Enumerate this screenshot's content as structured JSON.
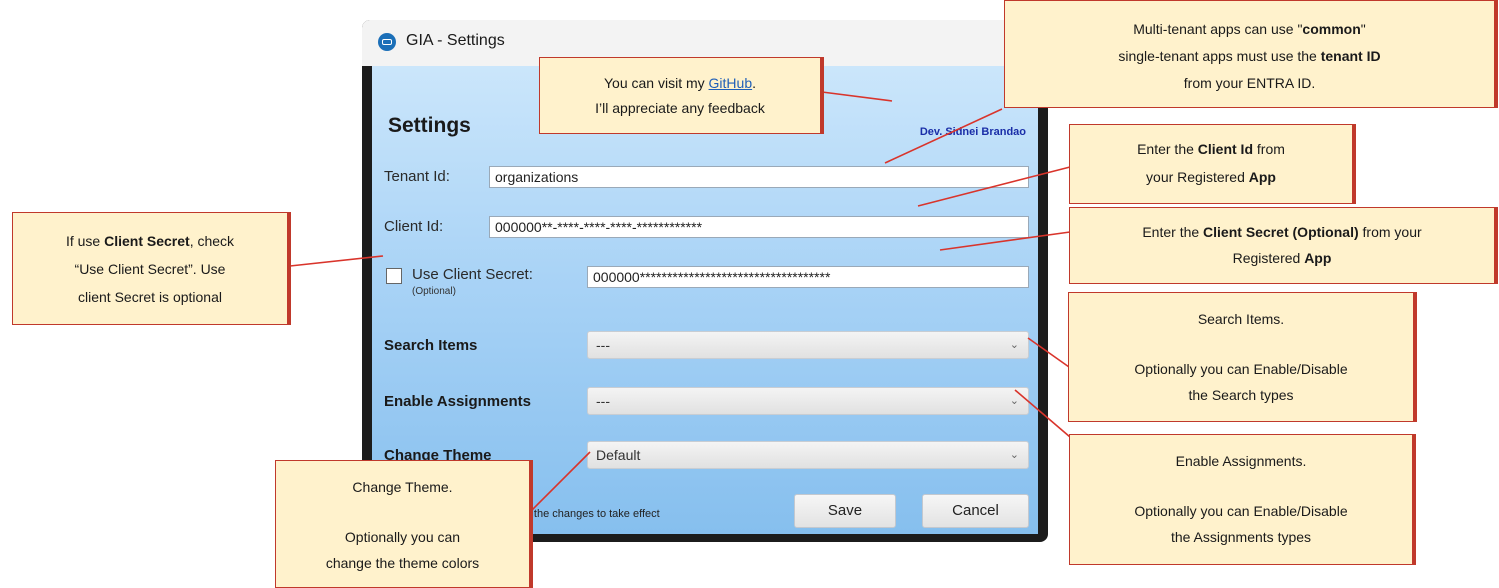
{
  "window": {
    "title": "GIA - Settings",
    "close_glyph": "✕",
    "app_icon": "app-icon"
  },
  "settings": {
    "heading": "Settings",
    "developer": "Dev. Sidnei Brandao",
    "tenant_label": "Tenant Id:",
    "tenant_value": "organizations",
    "client_label": "Client Id:",
    "client_value": "000000**-****-****-****-************",
    "use_secret_label": "Use Client Secret:",
    "use_secret_optional": "(Optional)",
    "use_secret_checked": false,
    "secret_value": "000000***********************************",
    "search_items_label": "Search Items",
    "search_items_value": "---",
    "enable_assignments_label": "Enable Assignments",
    "enable_assignments_value": "---",
    "change_theme_label": "Change Theme",
    "change_theme_value": "Default",
    "note_text": "for the changes to take effect",
    "save_label": "Save",
    "cancel_label": "Cancel"
  },
  "callouts": {
    "github": {
      "pre": "You can visit my ",
      "link": "GitHub",
      "post": ".",
      "line2": "I’ll appreciate any feedback"
    },
    "tenant": {
      "l1_pre": "Multi-tenant apps can use \"",
      "l1_bold": "common",
      "l1_post": "\"",
      "l2_pre": "single-tenant apps must use the ",
      "l2_bold": "tenant ID",
      "l3": "from your ENTRA ID."
    },
    "client_id": {
      "l1_pre": "Enter the ",
      "l1_bold": "Client Id",
      "l1_post": " from",
      "l2_pre": "your Registered ",
      "l2_bold": "App"
    },
    "client_secret": {
      "l1_pre": "Enter the ",
      "l1_bold": "Client Secret (Optional)",
      "l1_post": " from your",
      "l2_pre": "Registered ",
      "l2_bold": "App"
    },
    "use_secret": {
      "l1_pre": "If use ",
      "l1_bold": "Client Secret",
      "l1_post": ", check",
      "l2": "“Use Client Secret”. Use",
      "l3": "client Secret is optional"
    },
    "search_items": {
      "l1": "Search Items.",
      "l2": "Optionally you can Enable/Disable",
      "l3": "the Search types"
    },
    "enable_assignments": {
      "l1": "Enable Assignments.",
      "l2": "Optionally you can Enable/Disable",
      "l3": "the Assignments types"
    },
    "change_theme": {
      "l1": "Change Theme.",
      "l2": "Optionally you can",
      "l3": "change the theme colors"
    }
  },
  "colors": {
    "callout_fill": "#fff2cc",
    "callout_border": "#c0392b",
    "link": "#1f5fb8",
    "developer": "#1a2ea8"
  }
}
